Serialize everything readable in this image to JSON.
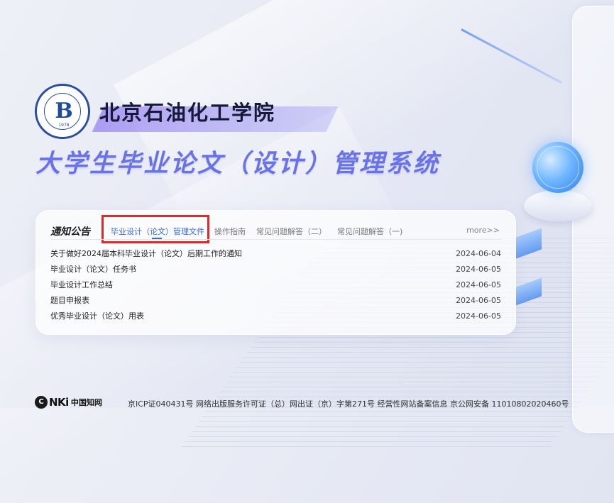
{
  "header": {
    "school_name": "北京石油化工学院",
    "system_title": "大学生毕业论文（设计）管理系统",
    "logo_year": "1978",
    "logo_name": "北京石油化工学院"
  },
  "notice": {
    "heading": "通知公告",
    "tabs": [
      {
        "label": "毕业设计（论文）管理文件",
        "active": true
      },
      {
        "label": "操作指南",
        "active": false
      },
      {
        "label": "常见问题解答（二）",
        "active": false
      },
      {
        "label": "常见问题解答（一)",
        "active": false
      }
    ],
    "more": "more>>",
    "items": [
      {
        "title": "关于做好2024届本科毕业设计（论文）后期工作的通知",
        "date": "2024-06-04"
      },
      {
        "title": "毕业设计（论文）任务书",
        "date": "2024-06-05"
      },
      {
        "title": "毕业设计工作总结",
        "date": "2024-06-05"
      },
      {
        "title": "题目申报表",
        "date": "2024-06-05"
      },
      {
        "title": "优秀毕业设计（论文）用表",
        "date": "2024-06-05"
      }
    ]
  },
  "footer": {
    "cnki_letter": "C",
    "cnki_brand": "NKi",
    "cnki_cn": "中国知网",
    "info": "京ICP证040431号 网络出版服务许可证（总）网出证（京）字第271号 经营性网站备案信息 京公网安备 11010802020460号"
  },
  "colors": {
    "title_accent": "#6a73e6",
    "active_tab": "#3a6ad6",
    "highlight_box": "#e0292b"
  }
}
